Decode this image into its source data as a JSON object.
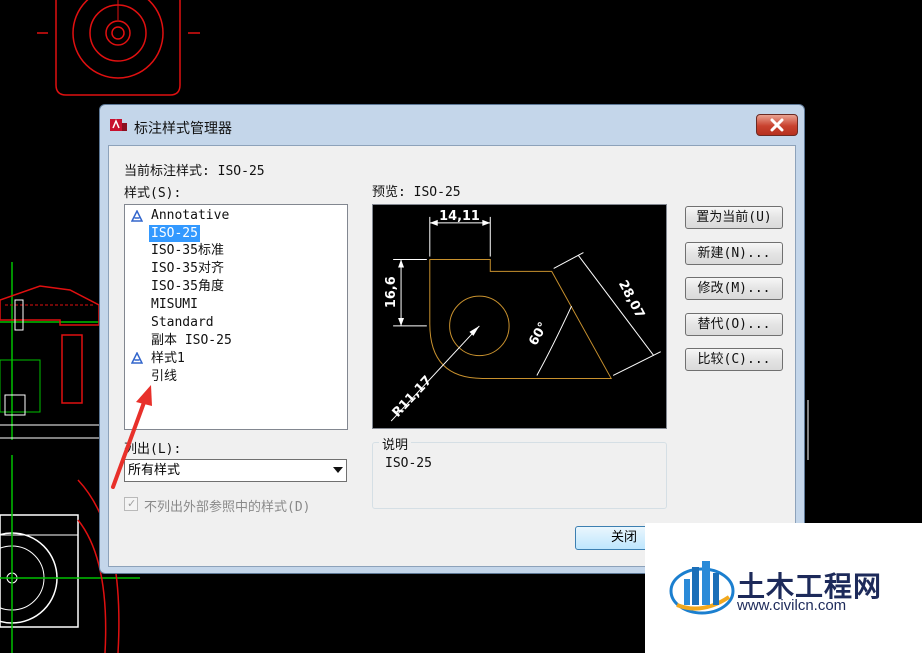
{
  "dialog": {
    "title": "标注样式管理器",
    "current_style_label": "当前标注样式: ISO-25",
    "styles_label": "样式(S):",
    "preview_label": "预览: ISO-25",
    "styles": [
      {
        "name": "Annotative",
        "annotative": true,
        "selected": false
      },
      {
        "name": "ISO-25",
        "annotative": false,
        "selected": true
      },
      {
        "name": "ISO-35标准",
        "annotative": false,
        "selected": false
      },
      {
        "name": "ISO-35对齐",
        "annotative": false,
        "selected": false
      },
      {
        "name": "ISO-35角度",
        "annotative": false,
        "selected": false
      },
      {
        "name": "MISUMI",
        "annotative": false,
        "selected": false
      },
      {
        "name": "Standard",
        "annotative": false,
        "selected": false
      },
      {
        "name": "副本 ISO-25",
        "annotative": false,
        "selected": false
      },
      {
        "name": "样式1",
        "annotative": true,
        "selected": false
      },
      {
        "name": "引线",
        "annotative": false,
        "selected": false
      }
    ],
    "list_label": "列出(L):",
    "list_value": "所有样式",
    "exclude_xref_label": "不列出外部参照中的样式(D)",
    "exclude_xref_checked": true,
    "description_title": "说明",
    "description_text": "ISO-25",
    "buttons": {
      "set_current": "置为当前(U)",
      "new": "新建(N)...",
      "modify": "修改(M)...",
      "override": "替代(O)...",
      "compare": "比较(C)..."
    },
    "close_label": "关闭"
  },
  "preview_dims": {
    "top": "14,11",
    "left": "16,6",
    "diag": "28,07",
    "angle": "60°",
    "radius": "R11,17"
  },
  "watermark": {
    "name": "土木工程网",
    "url": "www.civilcn.com"
  },
  "colors": {
    "selection": "#3399ff",
    "annotation_arrow": "#e8302a",
    "cad_green": "#00c000",
    "cad_red": "#e01010"
  }
}
